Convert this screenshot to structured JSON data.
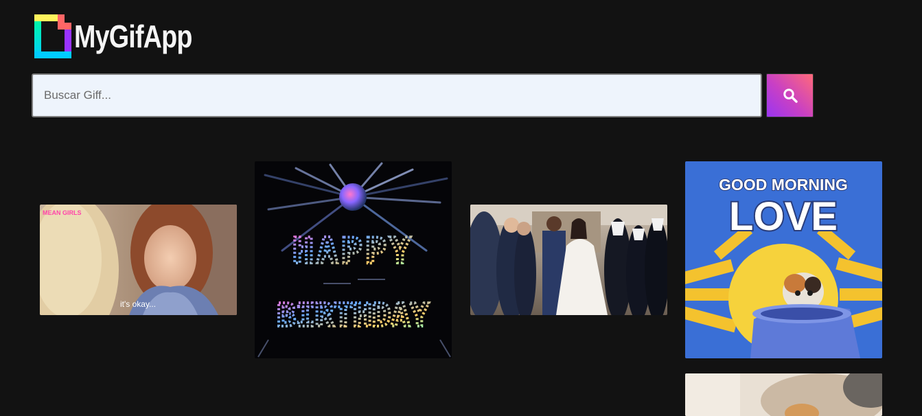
{
  "app": {
    "title": "MyGifApp"
  },
  "search": {
    "placeholder": "Buscar Giff...",
    "value": "",
    "button_icon": "search-icon"
  },
  "gifs": [
    {
      "name": "gif-mean-girls",
      "description_icon": "gif-thumbnail",
      "watermark": "MEAN GIRLS",
      "caption": "it's okay..."
    },
    {
      "name": "gif-happy-birthday",
      "description_icon": "gif-thumbnail",
      "line1": "HAPPY",
      "line2": "BIRTHDAY"
    },
    {
      "name": "gif-wedding",
      "description_icon": "gif-thumbnail"
    },
    {
      "name": "gif-good-morning-love",
      "description_icon": "gif-thumbnail",
      "line1": "GOOD MORNING",
      "line2": "LOVE"
    },
    {
      "name": "gif-partial",
      "description_icon": "gif-thumbnail"
    }
  ],
  "colors": {
    "background": "#121212",
    "search_bg": "#eef4fc",
    "button_gradient_start": "#9a35f2",
    "button_gradient_end": "#ff6a7a"
  }
}
